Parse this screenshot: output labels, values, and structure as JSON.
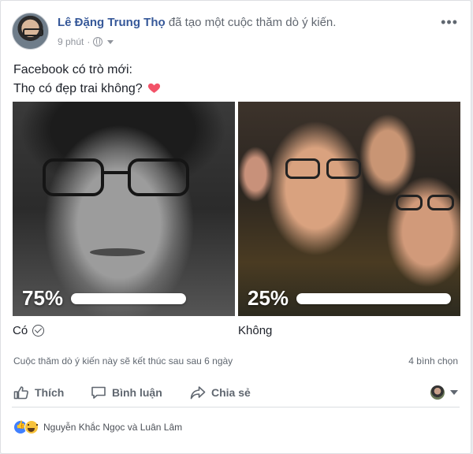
{
  "post": {
    "author": "Lê Đặng Trung Thọ",
    "action_text": " đã tạo một cuộc thăm dò ý kiến.",
    "time": "9 phút",
    "text_line1": "Facebook có trò mới:",
    "text_line2": "Thọ có đẹp trai không?",
    "more_icon": "more-icon"
  },
  "poll": {
    "options": [
      {
        "label": "Có",
        "percent": "75%",
        "fraction": 0.75,
        "selected": true,
        "image_icon": "portrait-bw"
      },
      {
        "label": "Không",
        "percent": "25%",
        "fraction": 0.25,
        "selected": false,
        "image_icon": "group-selfie"
      }
    ],
    "ends_text": "Cuộc thăm dò ý kiến này sẽ kết thúc sau sau 6 ngày",
    "votes_text": "4 bình chọn"
  },
  "actions": {
    "like_label": "Thích",
    "comment_label": "Bình luận",
    "share_label": "Chia sẻ"
  },
  "reactions": {
    "names": "Nguyễn Khắc Ngọc và Luân Lâm",
    "types": [
      "like",
      "haha"
    ]
  },
  "colors": {
    "link": "#365899",
    "heart": "#f25268",
    "like_blue": "#4080ff"
  }
}
